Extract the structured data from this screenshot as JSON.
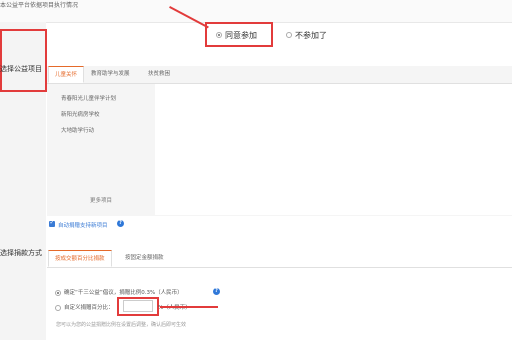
{
  "header": {
    "top_text": "本公益平台依据项目执行情况"
  },
  "participation": {
    "agree_label": "同意参加",
    "decline_label": "不参加了"
  },
  "project_section": {
    "label": "选择公益项目",
    "tabs": [
      {
        "label": "儿童关怀",
        "active": true
      },
      {
        "label": "教育助学与发展",
        "active": false
      },
      {
        "label": "扶贫救困",
        "active": false
      }
    ],
    "items": [
      "青春阳光儿童伴学计划",
      "新阳光病房学校",
      "大地助学行动"
    ],
    "more_label": "更多项目",
    "auto_check_label": "自动捐赠支持新项目"
  },
  "donation_section": {
    "label": "选择捐款方式",
    "tabs": [
      {
        "label": "按成交额百分比捐款",
        "active": true
      },
      {
        "label": "按固定金额捐款",
        "active": false
      }
    ],
    "option1_label": "确定“千三公益”倡议，捐赠比例0.3%（人民币）",
    "option2_prefix": "自定义捐赠百分比：",
    "option2_suffix": "%（人民币）",
    "option2_value": "",
    "footnote": "您可以为您的公益捐赠比例在设置后调整，确认后即可生效"
  },
  "colors": {
    "accent": "#e56a2a",
    "highlight": "#e23b3b",
    "link": "#3a7bd5"
  }
}
